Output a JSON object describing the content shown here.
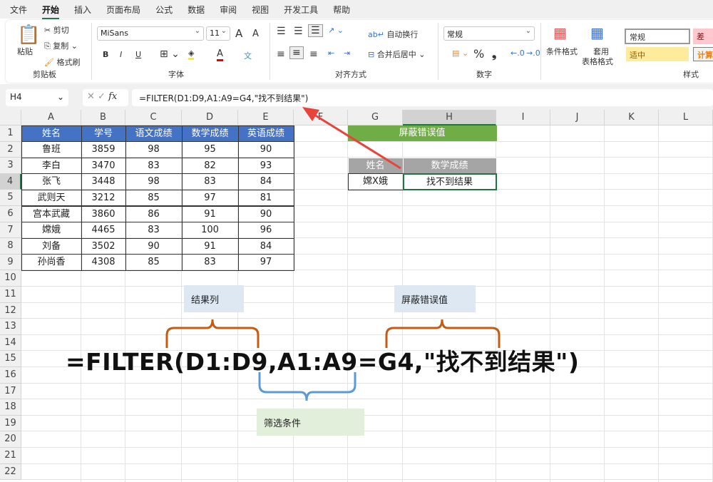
{
  "menu": [
    "文件",
    "开始",
    "插入",
    "页面布局",
    "公式",
    "数据",
    "审阅",
    "视图",
    "开发工具",
    "帮助"
  ],
  "ribbon": {
    "clipboard": {
      "paste": "粘贴",
      "cut": "剪切",
      "copy": "复制",
      "format_painter": "格式刷",
      "group": "剪贴板"
    },
    "font": {
      "name": "MiSans",
      "size": "11",
      "bold": "B",
      "italic": "I",
      "underline": "U",
      "group": "字体",
      "grow": "A",
      "shrink": "A",
      "font_color": "A",
      "phonetic": "文"
    },
    "alignment": {
      "wrap": "自动换行",
      "merge": "合并后居中",
      "group": "对齐方式"
    },
    "number": {
      "format": "常规",
      "percent": "%",
      "comma": "❟",
      "group": "数字"
    },
    "styles": {
      "conditional": "条件格式",
      "table1": "套用",
      "table2": "表格格式",
      "normal": "常规",
      "bad": "差",
      "neutral": "适中",
      "calc": "计算",
      "group": "样式"
    }
  },
  "formula_bar": {
    "name_box": "H4",
    "formula": "=FILTER(D1:D9,A1:A9=G4,\"找不到结果\")",
    "fx": "fx"
  },
  "columns": [
    "A",
    "B",
    "C",
    "D",
    "E",
    "F",
    "G",
    "H",
    "I",
    "J",
    "K",
    "L"
  ],
  "rows": [
    "1",
    "2",
    "3",
    "4",
    "5",
    "6",
    "7",
    "8",
    "9",
    "10",
    "11",
    "12",
    "13",
    "14",
    "15",
    "16",
    "17",
    "18",
    "19",
    "20",
    "21",
    "22"
  ],
  "table": {
    "headers": [
      "姓名",
      "学号",
      "语文成绩",
      "数学成绩",
      "英语成绩"
    ],
    "rows": [
      [
        "鲁班",
        "3859",
        "98",
        "95",
        "90"
      ],
      [
        "李白",
        "3470",
        "83",
        "82",
        "93"
      ],
      [
        "张飞",
        "3448",
        "98",
        "83",
        "84"
      ],
      [
        "武则天",
        "3212",
        "85",
        "97",
        "81"
      ],
      [
        "宫本武藏",
        "3860",
        "86",
        "91",
        "90"
      ],
      [
        "嫦娥",
        "4465",
        "83",
        "100",
        "96"
      ],
      [
        "刘备",
        "3502",
        "90",
        "91",
        "84"
      ],
      [
        "孙尚香",
        "4308",
        "85",
        "83",
        "97"
      ]
    ]
  },
  "lookup": {
    "title": "屏蔽错误值",
    "headers": [
      "姓名",
      "数学成绩"
    ],
    "name": "嫦X娥",
    "result": "找不到结果"
  },
  "annotations": {
    "result_col": "结果列",
    "mask_error": "屏蔽错误值",
    "filter_cond": "筛选条件",
    "big_formula": "=FILTER(D1:D9,A1:A9=G4,\"找不到结果\")"
  },
  "colors": {
    "header_blue": "#4472c4",
    "green": "#70ad47",
    "gray": "#a5a5a5",
    "brace_orange": "#c55a11",
    "brace_blue": "#5b9bd5",
    "arrow_red": "#e8443a"
  }
}
